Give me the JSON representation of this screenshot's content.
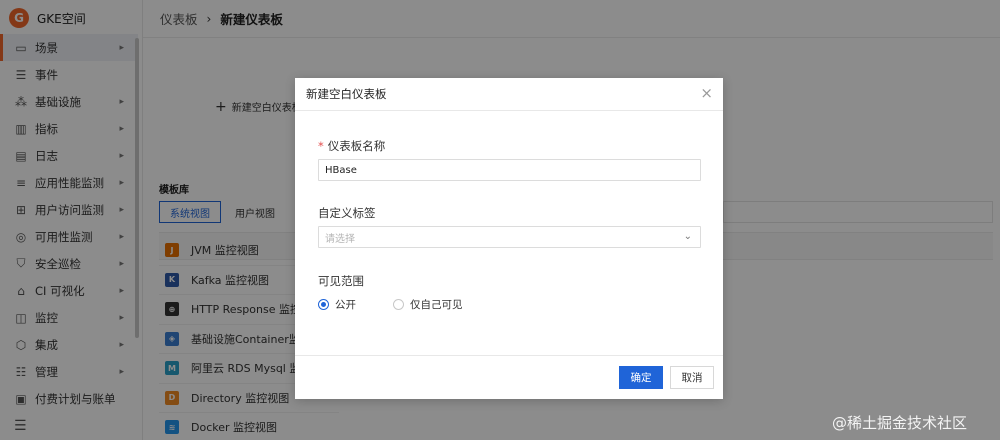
{
  "app": {
    "logo_letter": "G",
    "name": "GKE空间"
  },
  "sidebar": {
    "items": [
      {
        "label": "场景",
        "icon": "monitor-icon",
        "glyph": "▭",
        "arrow": true,
        "active": true
      },
      {
        "label": "事件",
        "icon": "event-icon",
        "glyph": "☰",
        "arrow": false
      },
      {
        "label": "基础设施",
        "icon": "infrastructure-icon",
        "glyph": "⁂",
        "arrow": true
      },
      {
        "label": "指标",
        "icon": "metrics-icon",
        "glyph": "▥",
        "arrow": true
      },
      {
        "label": "日志",
        "icon": "log-icon",
        "glyph": "▤",
        "arrow": true
      },
      {
        "label": "应用性能监测",
        "icon": "apm-icon",
        "glyph": "≡",
        "arrow": true
      },
      {
        "label": "用户访问监测",
        "icon": "rum-icon",
        "glyph": "⊞",
        "arrow": true
      },
      {
        "label": "可用性监测",
        "icon": "availability-icon",
        "glyph": "◎",
        "arrow": true
      },
      {
        "label": "安全巡检",
        "icon": "shield-icon",
        "glyph": "⛉",
        "arrow": true
      },
      {
        "label": "CI 可视化",
        "icon": "ci-icon",
        "glyph": "⌂",
        "arrow": true
      },
      {
        "label": "监控",
        "icon": "monitor-alarm-icon",
        "glyph": "◫",
        "arrow": true
      },
      {
        "label": "集成",
        "icon": "integration-icon",
        "glyph": "⬡",
        "arrow": true
      },
      {
        "label": "管理",
        "icon": "settings-icon",
        "glyph": "☷",
        "arrow": true
      },
      {
        "label": "付费计划与账单",
        "icon": "billing-icon",
        "glyph": "▣",
        "arrow": false
      }
    ],
    "collapse_glyph": "☰"
  },
  "header": {
    "breadcrumb_parent": "仪表板",
    "breadcrumb_sep": "›",
    "breadcrumb_current": "新建仪表板"
  },
  "content": {
    "new_blank_label": "新建空白仪表板",
    "library_title": "模板库",
    "tabs": [
      "系统视图",
      "用户视图"
    ],
    "templates": [
      {
        "label": "JVM 监控视图",
        "icon": "java-icon",
        "color": "#e76f00",
        "glyph": "J"
      },
      {
        "label": "Kafka 监控视图",
        "icon": "kafka-icon",
        "color": "#2f5aa8",
        "glyph": "K"
      },
      {
        "label": "HTTP Response 监控视图",
        "icon": "globe-icon",
        "color": "#333333",
        "glyph": "⊕"
      },
      {
        "label": "基础设施Container监控视图",
        "icon": "container-icon",
        "color": "#3b7fd1",
        "glyph": "◈"
      },
      {
        "label": "阿里云 RDS Mysql 监控视图",
        "icon": "mysql-icon",
        "color": "#2aa0c8",
        "glyph": "M"
      },
      {
        "label": "Directory 监控视图",
        "icon": "directory-icon",
        "color": "#f08a24",
        "glyph": "D"
      },
      {
        "label": "Docker 监控视图",
        "icon": "docker-icon",
        "color": "#2496ed",
        "glyph": "≋"
      }
    ]
  },
  "modal": {
    "title": "新建空白仪表板",
    "close_glyph": "×",
    "name_label": "仪表板名称",
    "required_mark": "*",
    "name_value": "HBase",
    "tags_label": "自定义标签",
    "tags_placeholder": "请选择",
    "visibility_label": "可见范围",
    "options": [
      "公开",
      "仅自己可见"
    ],
    "selected_option": "公开",
    "ok_label": "确定",
    "cancel_label": "取消"
  },
  "watermark": "@稀土掘金技术社区",
  "colors": {
    "accent": "#1f64d8",
    "brand": "#f0662a"
  }
}
